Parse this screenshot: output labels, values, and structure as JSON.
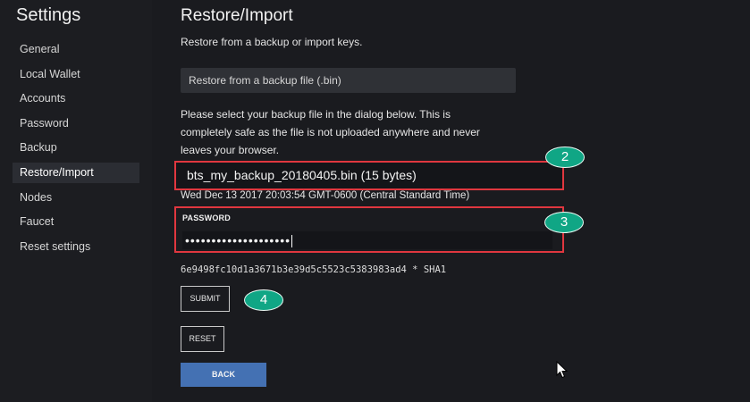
{
  "sidebar": {
    "title": "Settings",
    "items": [
      {
        "label": "General"
      },
      {
        "label": "Local Wallet"
      },
      {
        "label": "Accounts"
      },
      {
        "label": "Password"
      },
      {
        "label": "Backup"
      },
      {
        "label": "Restore/Import",
        "active": true
      },
      {
        "label": "Nodes"
      },
      {
        "label": "Faucet"
      },
      {
        "label": "Reset settings"
      }
    ]
  },
  "main": {
    "title": "Restore/Import",
    "subtitle": "Restore from a backup or import keys.",
    "restore_option": "Restore from a backup file (.bin)",
    "instructions": "Please select your backup file in the dialog below. This is completely safe as the file is not uploaded anywhere and never leaves your browser.",
    "file_name": "bts_my_backup_20180405.bin (15 bytes)",
    "file_date": "Wed Dec 13 2017 20:03:54 GMT-0600 (Central Standard Time)",
    "password_label": "PASSWORD",
    "password_mask": "••••••••••••••••••••",
    "hash": "6e9498fc10d1a3671b3e39d5c5523c5383983ad4 * SHA1",
    "submit_label": "SUBMIT",
    "reset_label": "RESET",
    "back_label": "BACK"
  },
  "annotations": {
    "step2": "2",
    "step3": "3",
    "step4": "4"
  },
  "colors": {
    "highlight": "#e0373f",
    "badge": "#10a685",
    "back_button": "#4471b3"
  }
}
